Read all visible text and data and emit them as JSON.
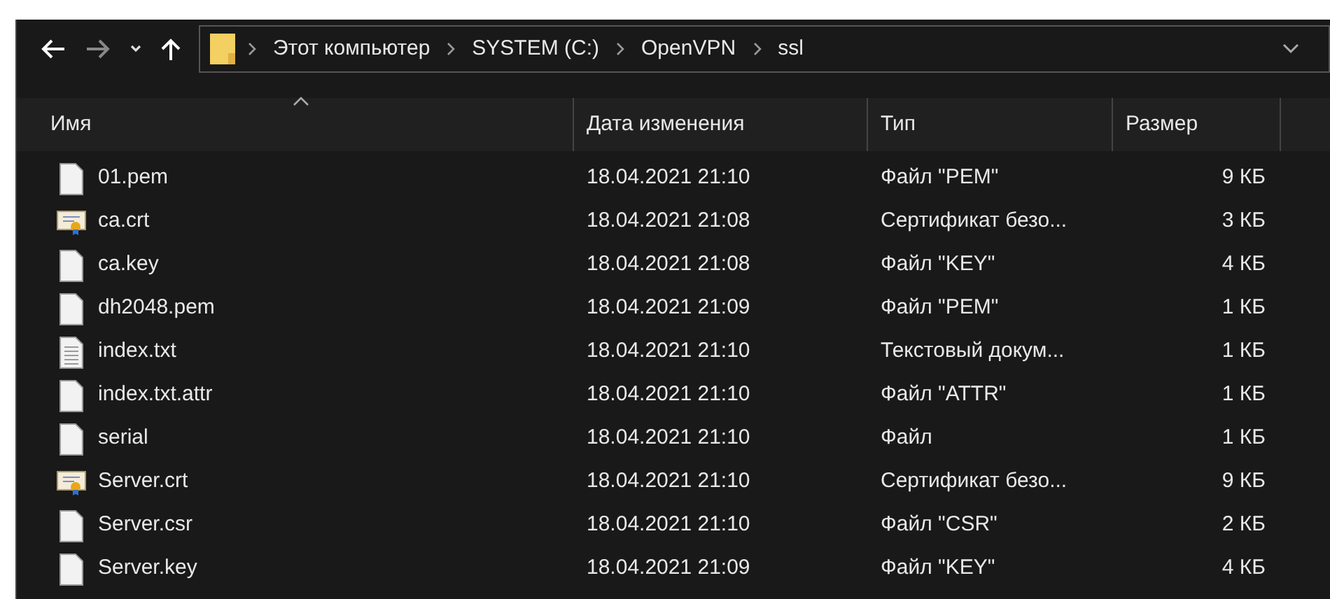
{
  "breadcrumb": [
    "Этот компьютер",
    "SYSTEM (C:)",
    "OpenVPN",
    "ssl"
  ],
  "table": {
    "columns": [
      "Имя",
      "Дата изменения",
      "Тип",
      "Размер"
    ],
    "rows": [
      {
        "kind": "file",
        "name": "01.pem",
        "date": "18.04.2021 21:10",
        "type": "Файл \"PEM\"",
        "size": "9 КБ"
      },
      {
        "kind": "cert",
        "name": "ca.crt",
        "date": "18.04.2021 21:08",
        "type": "Сертификат безо...",
        "size": "3 КБ"
      },
      {
        "kind": "file",
        "name": "ca.key",
        "date": "18.04.2021 21:08",
        "type": "Файл \"KEY\"",
        "size": "4 КБ"
      },
      {
        "kind": "file",
        "name": "dh2048.pem",
        "date": "18.04.2021 21:09",
        "type": "Файл \"PEM\"",
        "size": "1 КБ"
      },
      {
        "kind": "text",
        "name": "index.txt",
        "date": "18.04.2021 21:10",
        "type": "Текстовый докум...",
        "size": "1 КБ"
      },
      {
        "kind": "file",
        "name": "index.txt.attr",
        "date": "18.04.2021 21:10",
        "type": "Файл \"ATTR\"",
        "size": "1 КБ"
      },
      {
        "kind": "file",
        "name": "serial",
        "date": "18.04.2021 21:10",
        "type": "Файл",
        "size": "1 КБ"
      },
      {
        "kind": "cert",
        "name": "Server.crt",
        "date": "18.04.2021 21:10",
        "type": "Сертификат безо...",
        "size": "9 КБ"
      },
      {
        "kind": "file",
        "name": "Server.csr",
        "date": "18.04.2021 21:10",
        "type": "Файл \"CSR\"",
        "size": "2 КБ"
      },
      {
        "kind": "file",
        "name": "Server.key",
        "date": "18.04.2021 21:09",
        "type": "Файл \"KEY\"",
        "size": "4 КБ"
      }
    ]
  }
}
